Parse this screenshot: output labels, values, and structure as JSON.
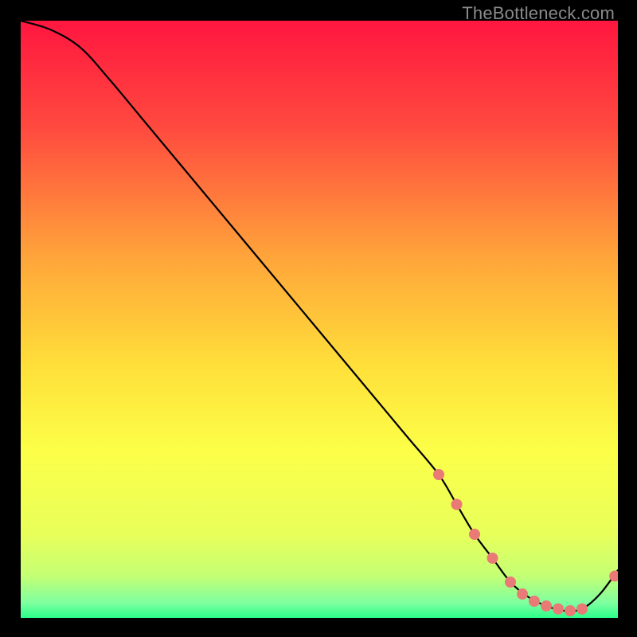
{
  "watermark": "TheBottleneck.com",
  "colors": {
    "background": "#000000",
    "gradient_top": "#ff163f",
    "gradient_mid_upper": "#ff7a3a",
    "gradient_mid": "#ffd53a",
    "gradient_mid_lower": "#f7ff4a",
    "gradient_lower": "#d6ff7a",
    "gradient_bottom": "#2aff8a",
    "curve": "#000000",
    "marker": "#e97a76"
  },
  "chart_data": {
    "type": "line",
    "title": "",
    "xlabel": "",
    "ylabel": "",
    "xlim": [
      0,
      100
    ],
    "ylim": [
      0,
      100
    ],
    "grid": false,
    "legend": null,
    "x": [
      0,
      5,
      10,
      15,
      20,
      25,
      30,
      35,
      40,
      45,
      50,
      55,
      60,
      65,
      70,
      73,
      76,
      79,
      82,
      85,
      88,
      91,
      94,
      97,
      100
    ],
    "values": [
      100,
      98.5,
      95.5,
      90,
      84,
      78,
      72,
      66,
      60,
      54,
      48,
      42,
      36,
      30,
      24,
      19,
      14,
      10,
      6,
      3.5,
      2,
      1.2,
      1.5,
      4,
      8
    ],
    "markers": {
      "x": [
        70,
        73,
        76,
        79,
        82,
        84,
        86,
        88,
        90,
        92,
        94,
        99.5
      ],
      "y": [
        24,
        19,
        14,
        10,
        6,
        4,
        2.8,
        2,
        1.5,
        1.2,
        1.5,
        7
      ]
    }
  }
}
